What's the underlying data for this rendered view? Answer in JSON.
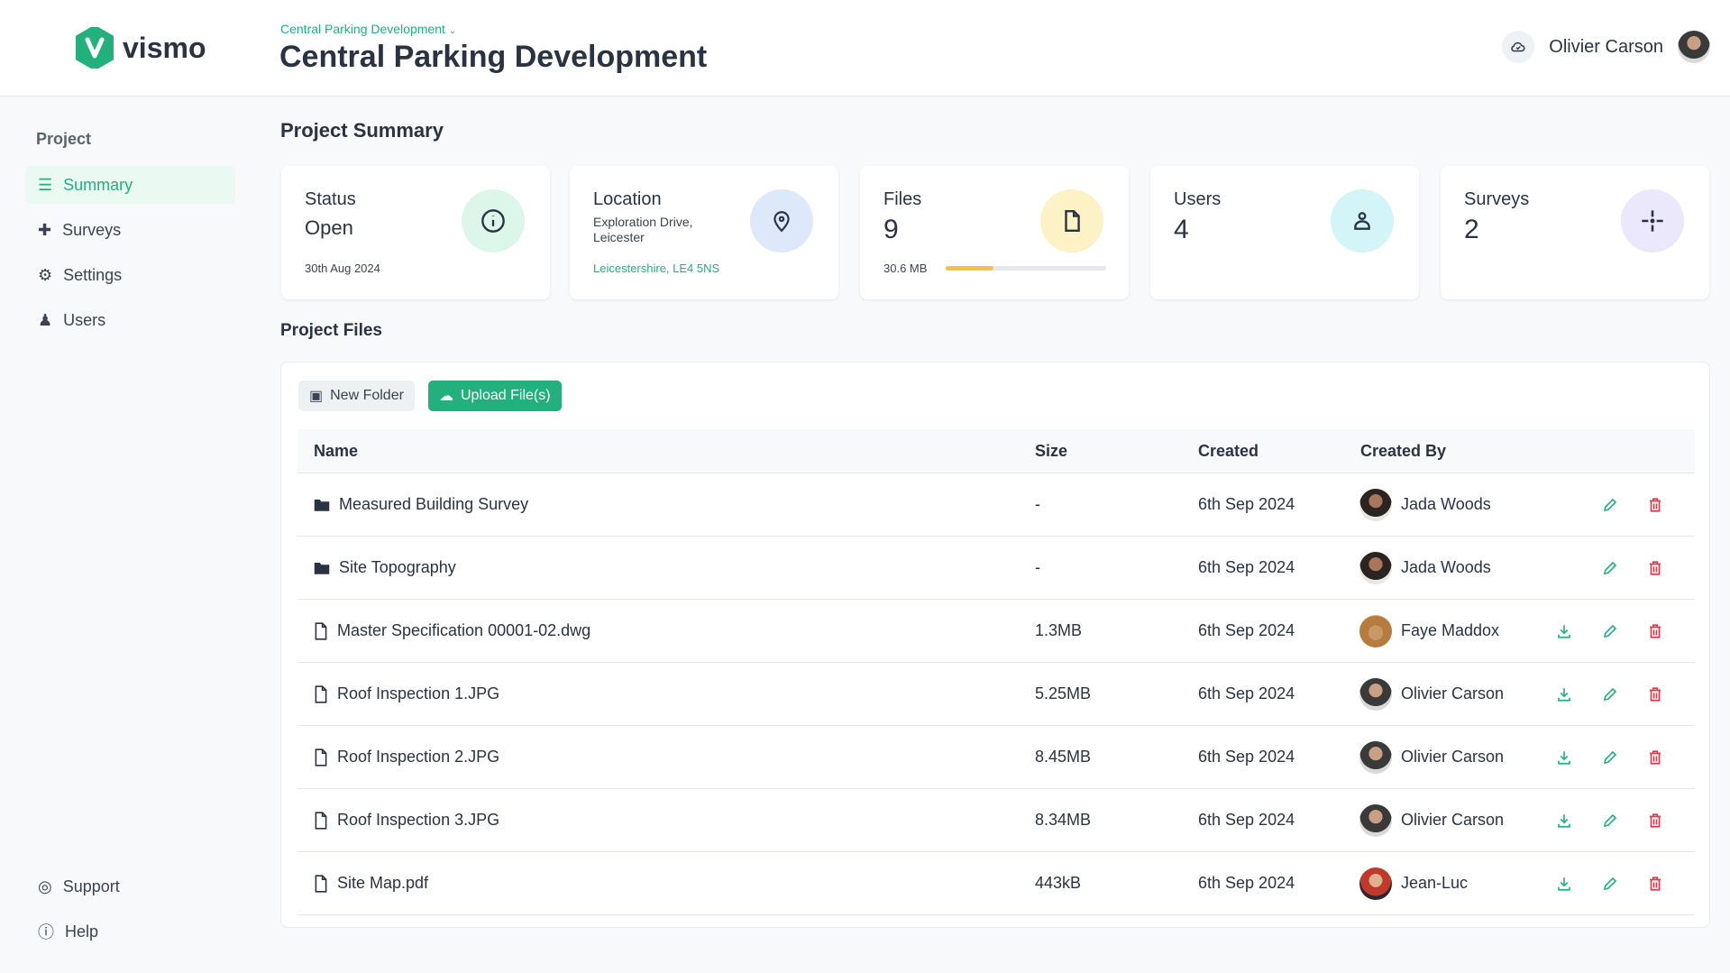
{
  "brand": {
    "name": "vismo",
    "color": "#22b07d"
  },
  "header": {
    "breadcrumb": "Central Parking Development",
    "title": "Central Parking Development",
    "user_name": "Olivier Carson"
  },
  "sidebar": {
    "section": "Project",
    "items": [
      {
        "label": "Summary",
        "icon": "list-icon",
        "active": true
      },
      {
        "label": "Surveys",
        "icon": "crosshair-icon"
      },
      {
        "label": "Settings",
        "icon": "gear-icon"
      },
      {
        "label": "Users",
        "icon": "user-icon"
      }
    ],
    "bottom": [
      {
        "label": "Support",
        "icon": "lifebuoy-icon"
      },
      {
        "label": "Help",
        "icon": "help-icon"
      }
    ]
  },
  "summary": {
    "title": "Project Summary",
    "status": {
      "label": "Status",
      "value": "Open",
      "date": "30th Aug 2024"
    },
    "location": {
      "label": "Location",
      "address": "Exploration Drive, Leicester",
      "region": "Leicestershire, LE4 5NS"
    },
    "files": {
      "label": "Files",
      "value": "9",
      "size": "30.6 MB",
      "usage_percent": 30
    },
    "users": {
      "label": "Users",
      "value": "4"
    },
    "surveys": {
      "label": "Surveys",
      "value": "2"
    }
  },
  "files": {
    "title": "Project Files",
    "new_folder": "New Folder",
    "upload": "Upload File(s)",
    "columns": [
      "Name",
      "Size",
      "Created",
      "Created By"
    ],
    "rows": [
      {
        "type": "folder",
        "name": "Measured Building Survey",
        "size": "-",
        "created": "6th Sep 2024",
        "by": "Jada Woods",
        "download": false
      },
      {
        "type": "folder",
        "name": "Site Topography",
        "size": "-",
        "created": "6th Sep 2024",
        "by": "Jada Woods",
        "download": false
      },
      {
        "type": "file",
        "name": "Master Specification 00001-02.dwg",
        "size": "1.3MB",
        "created": "6th Sep 2024",
        "by": "Faye Maddox",
        "download": true
      },
      {
        "type": "file",
        "name": "Roof Inspection 1.JPG",
        "size": "5.25MB",
        "created": "6th Sep 2024",
        "by": "Olivier Carson",
        "download": true
      },
      {
        "type": "file",
        "name": "Roof Inspection 2.JPG",
        "size": "8.45MB",
        "created": "6th Sep 2024",
        "by": "Olivier Carson",
        "download": true
      },
      {
        "type": "file",
        "name": "Roof Inspection 3.JPG",
        "size": "8.34MB",
        "created": "6th Sep 2024",
        "by": "Olivier Carson",
        "download": true
      },
      {
        "type": "file",
        "name": "Site Map.pdf",
        "size": "443kB",
        "created": "6th Sep 2024",
        "by": "Jean-Luc",
        "download": true
      }
    ]
  }
}
